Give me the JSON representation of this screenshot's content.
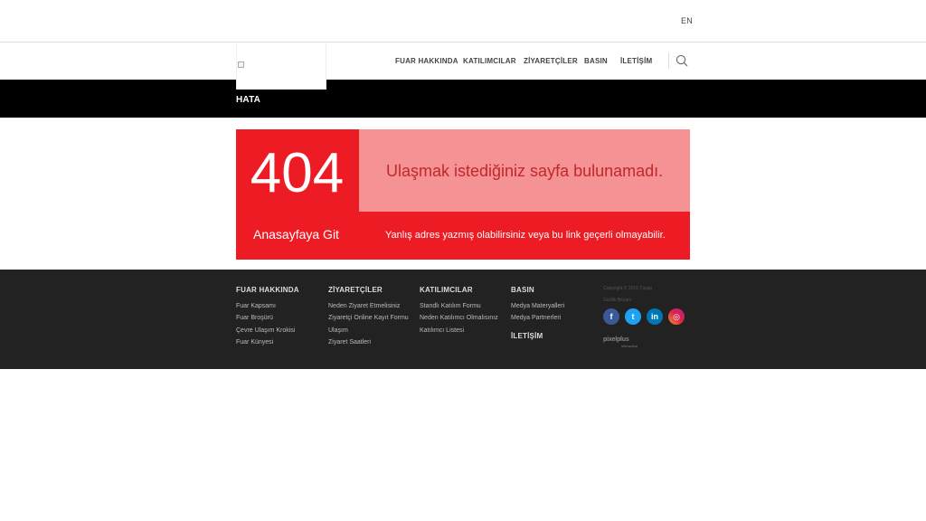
{
  "topbar": {
    "lang": "EN"
  },
  "header": {
    "logo_alt": "Fuar logosu",
    "nav": [
      "FUAR HAKKINDA",
      "KATILIMCILAR",
      "ZİYARETÇİLER",
      "BASIN",
      "İLETİŞİM"
    ]
  },
  "page": {
    "title": "HATA"
  },
  "error": {
    "code": "404",
    "message": "Ulaşmak istediğiniz sayfa bulunamadı.",
    "home_link": "Anasayfaya Git",
    "sub_message": "Yanlış adres yazmış olabilirsiniz veya bu link geçerli olmayabilir."
  },
  "footer": {
    "columns": [
      {
        "heading": "FUAR HAKKINDA",
        "links": [
          "Fuar Kapsamı",
          "Fuar Broşürü",
          "Çevre Ulaşım Krokisi",
          "Fuar Künyesi"
        ]
      },
      {
        "heading": "ZİYARETÇİLER",
        "links": [
          "Neden Ziyaret Etmelisiniz",
          "Ziyaretçi Online Kayıt Formu",
          "Ulaşım",
          "Ziyaret Saatleri"
        ]
      },
      {
        "heading": "KATILIMCILAR",
        "links": [
          "Standlı Katılım Formu",
          "Neden Katılımcı Olmalısınız",
          "Katılımcı Listesi"
        ]
      },
      {
        "heading": "BASIN",
        "links": [
          "Medya Materyalleri",
          "Medya Partnerleri"
        ]
      }
    ],
    "contact_heading": "İLETİŞİM",
    "copyright": "Copyright © 2016 Tüyap",
    "rights": "Gizlilik Beyanı",
    "social": {
      "facebook": "f",
      "twitter": "t",
      "linkedin": "in",
      "instagram": "◎"
    },
    "credit": {
      "name": "pixelplus",
      "sub": "interactive"
    }
  },
  "colors": {
    "accent": "#ed1c24",
    "accent_light": "#f59293",
    "footer_bg": "#222222"
  }
}
